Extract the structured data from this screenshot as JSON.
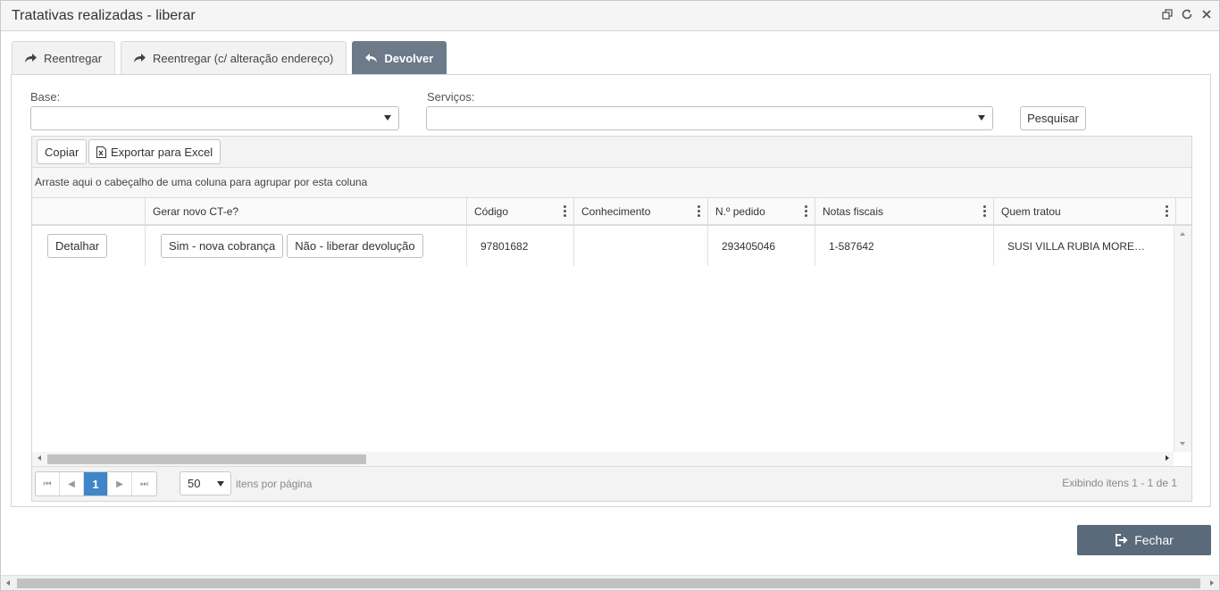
{
  "window": {
    "title": "Tratativas realizadas - liberar",
    "icons": [
      "restore-icon",
      "refresh-icon",
      "close-icon"
    ]
  },
  "tabs": [
    {
      "label": "Reentregar",
      "icon": "share-arrow-icon",
      "active": false
    },
    {
      "label": "Reentregar (c/ alteração endereço)",
      "icon": "share-arrow-icon",
      "active": false
    },
    {
      "label": "Devolver",
      "icon": "reply-arrow-icon",
      "active": true
    }
  ],
  "filters": {
    "base_label": "Base:",
    "base_value": "",
    "servicos_label": "Serviços:",
    "servicos_value": "",
    "search_label": "Pesquisar"
  },
  "grid": {
    "toolbar": {
      "copy_label": "Copiar",
      "export_label": "Exportar para Excel"
    },
    "grouping_hint": "Arraste aqui o cabeçalho de uma coluna para agrupar por esta coluna",
    "columns": [
      "",
      "Gerar novo CT-e?",
      "Código",
      "Conhecimento",
      "N.º pedido",
      "Notas fiscais",
      "Quem tratou"
    ],
    "rows": [
      {
        "detail_label": "Detalhar",
        "yes_label": "Sim - nova cobrança",
        "no_label": "Não - liberar devolução",
        "codigo": "97801682",
        "conhecimento": "",
        "pedido": "293405046",
        "notas": "1-587642",
        "quem_tratou": "SUSI VILLA RUBIA MORE…"
      }
    ],
    "pager": {
      "current_page": "1",
      "page_size": "50",
      "page_size_label": "itens por página",
      "info": "Exibindo itens 1 - 1 de 1"
    }
  },
  "footer": {
    "close_label": "Fechar"
  },
  "colors": {
    "active_tab": "#6c7a89",
    "close_button": "#5b6a7a",
    "current_page": "#3e86c8"
  }
}
